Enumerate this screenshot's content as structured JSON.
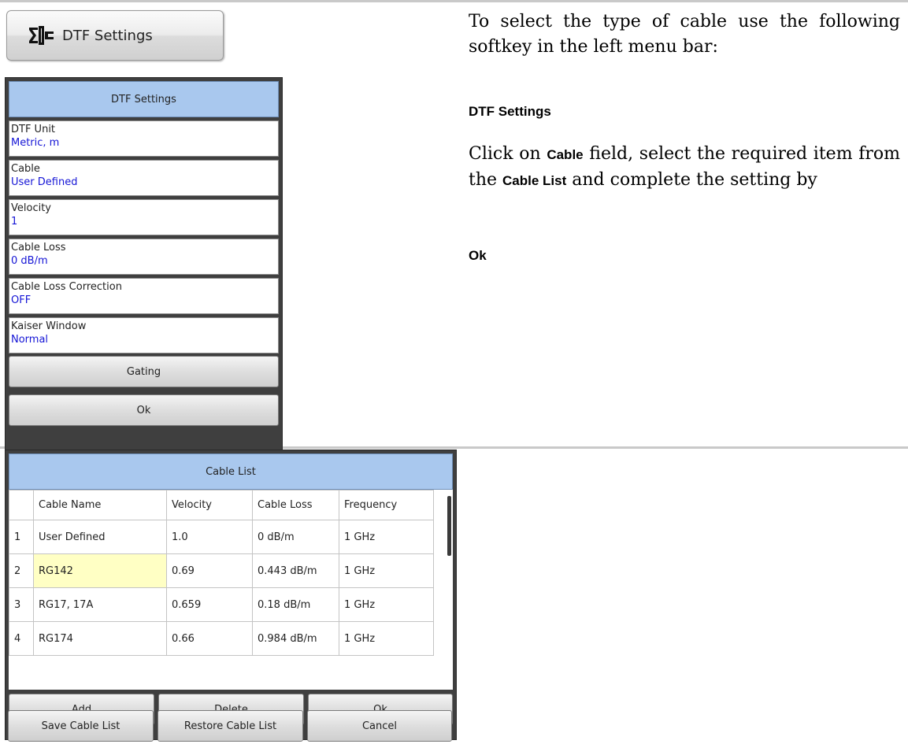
{
  "softkey": {
    "label": "DTF Settings",
    "icon": "dtf-icon"
  },
  "dtf_menu": {
    "title": "DTF Settings",
    "fields": [
      {
        "label": "DTF Unit",
        "value": "Metric, m"
      },
      {
        "label": "Cable",
        "value": "User Defined"
      },
      {
        "label": "Velocity",
        "value": "1"
      },
      {
        "label": "Cable Loss",
        "value": "0 dB/m"
      },
      {
        "label": "Cable Loss Correction",
        "value": "OFF"
      },
      {
        "label": "Kaiser Window",
        "value": "Normal"
      }
    ],
    "buttons": {
      "gating": "Gating",
      "ok": "Ok"
    }
  },
  "instructions": {
    "p1": "To select the type of cable use the following softkey in the left menu bar:",
    "key1": "DTF Settings",
    "p2_a": "Click on ",
    "p2_b": "Cable",
    "p2_c": " field, select the required item from the ",
    "p2_d": "Cable List",
    "p2_e": " and complete the setting by",
    "key2": "Ok"
  },
  "cable_list": {
    "title": "Cable List",
    "columns": [
      "",
      "Cable Name",
      "Velocity",
      "Cable Loss",
      "Frequency"
    ],
    "rows": [
      {
        "num": "1",
        "name": "User Defined",
        "velocity": "1.0",
        "loss": "0 dB/m",
        "freq": "1 GHz"
      },
      {
        "num": "2",
        "name": "RG142",
        "velocity": "0.69",
        "loss": "0.443 dB/m",
        "freq": "1 GHz"
      },
      {
        "num": "3",
        "name": "RG17, 17A",
        "velocity": "0.659",
        "loss": "0.18 dB/m",
        "freq": "1 GHz"
      },
      {
        "num": "4",
        "name": "RG174",
        "velocity": "0.66",
        "loss": "0.984 dB/m",
        "freq": "1 GHz"
      }
    ],
    "buttons": {
      "add": "Add",
      "delete": "Delete",
      "ok": "Ok",
      "save": "Save Cable List",
      "restore": "Restore Cable List",
      "cancel": "Cancel"
    },
    "highlight_color": "#ffffc4",
    "header_color": "#a9c8ee"
  }
}
